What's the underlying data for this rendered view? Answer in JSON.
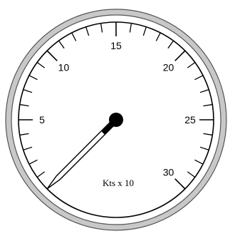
{
  "gauge": {
    "unit_label": "Kts x 10",
    "scale_labels": [
      "5",
      "10",
      "15",
      "20",
      "25",
      "30"
    ],
    "scale_values": [
      5,
      10,
      15,
      20,
      25,
      30
    ],
    "scale_min": 0,
    "scale_max": 30,
    "needle_value": 0,
    "colors": {
      "bezel": "#c8c8c8",
      "face": "#ffffff",
      "ink": "#000000"
    }
  }
}
